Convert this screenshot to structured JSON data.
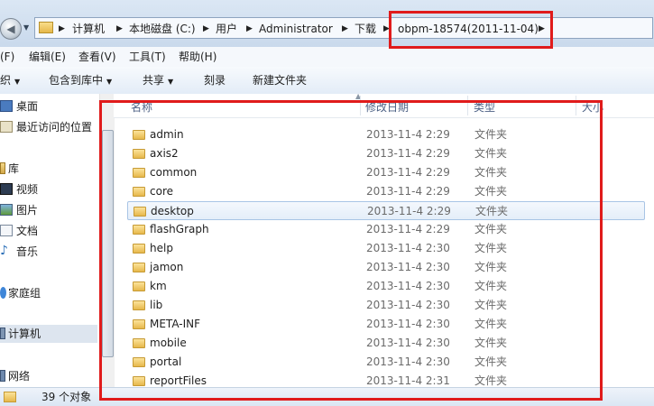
{
  "address": {
    "crumbs": [
      "计算机",
      "本地磁盘 (C:)",
      "用户",
      "Administrator",
      "下载",
      "obpm-18574(2011-11-04)"
    ]
  },
  "menu": [
    "(F)",
    "编辑(E)",
    "查看(V)",
    "工具(T)",
    "帮助(H)"
  ],
  "toolbar": {
    "organize": "织",
    "include": "包含到库中",
    "share": "共享",
    "burn": "刻录",
    "new_folder": "新建文件夹"
  },
  "nav": [
    "桌面",
    "最近访问的位置",
    "库",
    "视频",
    "图片",
    "文档",
    "音乐",
    "家庭组",
    "计算机",
    "网络"
  ],
  "columns": {
    "name": "名称",
    "date": "修改日期",
    "type": "类型",
    "size": "大小"
  },
  "files": [
    {
      "name": "admin",
      "date": "2013-11-4 2:29",
      "type": "文件夹"
    },
    {
      "name": "axis2",
      "date": "2013-11-4 2:29",
      "type": "文件夹"
    },
    {
      "name": "common",
      "date": "2013-11-4 2:29",
      "type": "文件夹"
    },
    {
      "name": "core",
      "date": "2013-11-4 2:29",
      "type": "文件夹"
    },
    {
      "name": "desktop",
      "date": "2013-11-4 2:29",
      "type": "文件夹"
    },
    {
      "name": "flashGraph",
      "date": "2013-11-4 2:29",
      "type": "文件夹"
    },
    {
      "name": "help",
      "date": "2013-11-4 2:30",
      "type": "文件夹"
    },
    {
      "name": "jamon",
      "date": "2013-11-4 2:30",
      "type": "文件夹"
    },
    {
      "name": "km",
      "date": "2013-11-4 2:30",
      "type": "文件夹"
    },
    {
      "name": "lib",
      "date": "2013-11-4 2:30",
      "type": "文件夹"
    },
    {
      "name": "META-INF",
      "date": "2013-11-4 2:30",
      "type": "文件夹"
    },
    {
      "name": "mobile",
      "date": "2013-11-4 2:30",
      "type": "文件夹"
    },
    {
      "name": "portal",
      "date": "2013-11-4 2:30",
      "type": "文件夹"
    },
    {
      "name": "reportFiles",
      "date": "2013-11-4 2:31",
      "type": "文件夹"
    }
  ],
  "status": {
    "count": "39 个对象"
  },
  "colors": {
    "highlight": "#e01b1b",
    "selection": "#e4eef9"
  }
}
